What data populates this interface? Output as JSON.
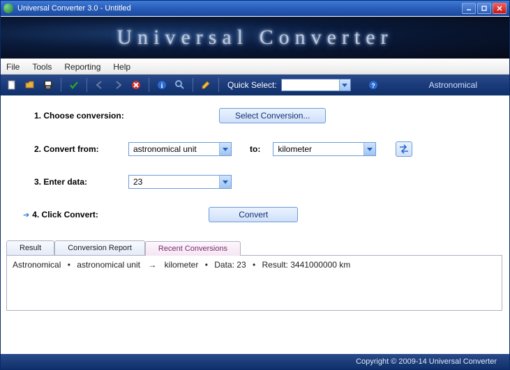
{
  "window": {
    "title": "Universal Converter 3.0    -    Untitled"
  },
  "banner": "Universal Converter",
  "menu": {
    "file": "File",
    "tools": "Tools",
    "reporting": "Reporting",
    "help": "Help"
  },
  "toolbar": {
    "quick_select_label": "Quick Select:",
    "quick_select_value": "",
    "category": "Astronomical"
  },
  "steps": {
    "s1": {
      "label": "1. Choose conversion:",
      "button": "Select Conversion..."
    },
    "s2": {
      "label": "2. Convert from:",
      "from": "astronomical unit",
      "to_label": "to:",
      "to": "kilometer"
    },
    "s3": {
      "label": "3. Enter data:",
      "value": "23"
    },
    "s4": {
      "label": "4. Click Convert:",
      "button": "Convert"
    }
  },
  "tabs": {
    "t1": "Result",
    "t2": "Conversion Report",
    "t3": "Recent Conversions"
  },
  "result_line": {
    "category": "Astronomical",
    "from": "astronomical unit",
    "to": "kilometer",
    "data_label": "Data:",
    "data": "23",
    "result_label": "Result:",
    "result": "3441000000 km"
  },
  "footer": "Copyright © 2009-14 Universal Converter"
}
